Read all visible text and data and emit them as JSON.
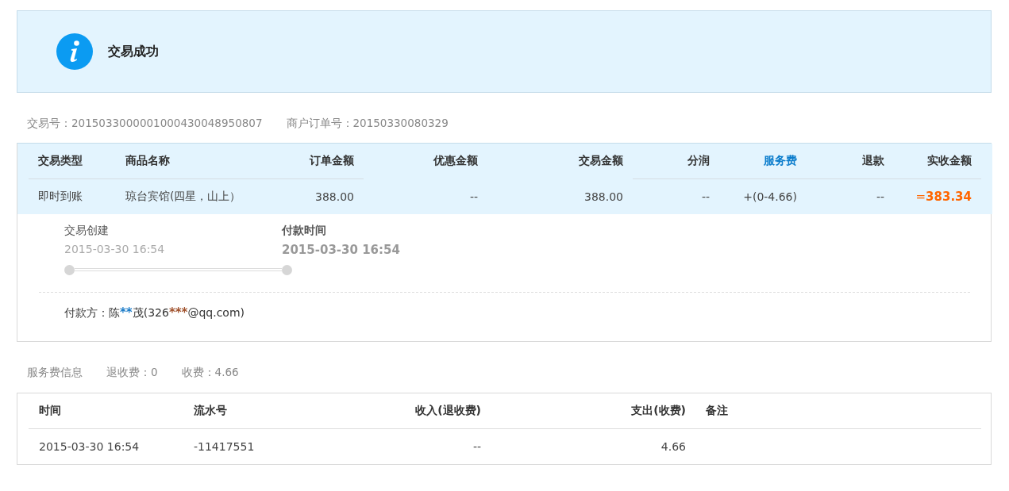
{
  "banner": {
    "title": "交易成功"
  },
  "trade_info": [
    {
      "label": "交易号：",
      "value": "2015033000001000430048950807"
    },
    {
      "label": "商户订单号：",
      "value": "20150330080329"
    }
  ],
  "order_table": {
    "columns": [
      {
        "label": "交易类型",
        "kind": "plain"
      },
      {
        "label": "商品名称",
        "kind": "plain"
      },
      {
        "label": "订单金额",
        "kind": "plain"
      },
      {
        "label": "优惠金额",
        "kind": "plain"
      },
      {
        "label": "交易金额",
        "kind": "plain"
      },
      {
        "label": "分润",
        "kind": "plain"
      },
      {
        "label": "服务费",
        "kind": "link"
      },
      {
        "label": "退款",
        "kind": "plain"
      },
      {
        "label": "实收金额",
        "kind": "plain"
      }
    ],
    "rows": [
      {
        "cells": [
          "即时到账",
          "琼台宾馆(四星，山上）",
          "388.00",
          "--",
          "388.00",
          "--",
          "+(0-4.66)",
          "--",
          "=**383.34**"
        ]
      }
    ]
  },
  "timeline": [
    {
      "label": "交易创建",
      "time": "2015-03-30 16:54",
      "selected": false
    },
    {
      "label": "付款时间",
      "time": "2015-03-30 16:54",
      "selected": true
    }
  ],
  "payer": [
    {
      "text": "付款方：陈",
      "color": "#333333",
      "kind": "plain"
    },
    {
      "text": "**",
      "color": "#1a7bc8",
      "kind": "mask"
    },
    {
      "text": "茂(326",
      "color": "#333333",
      "kind": "plain"
    },
    {
      "text": "***",
      "color": "#a0522d",
      "kind": "mask"
    },
    {
      "text": "@qq.com)",
      "color": "#333333",
      "kind": "plain"
    }
  ],
  "fee_info": [
    {
      "text": "服务费信息"
    },
    {
      "text": "退收费：0"
    },
    {
      "text": "收费：4.66"
    }
  ],
  "fee_table": {
    "columns": [
      {
        "label": "时间"
      },
      {
        "label": "流水号"
      },
      {
        "label": "收入(退收费)"
      },
      {
        "label": "支出(收费)"
      },
      {
        "label": "备注"
      }
    ],
    "rows": [
      {
        "cells": [
          "2015-03-30 16:54",
          "-11417551",
          "--",
          "4.66",
          ""
        ]
      }
    ]
  }
}
